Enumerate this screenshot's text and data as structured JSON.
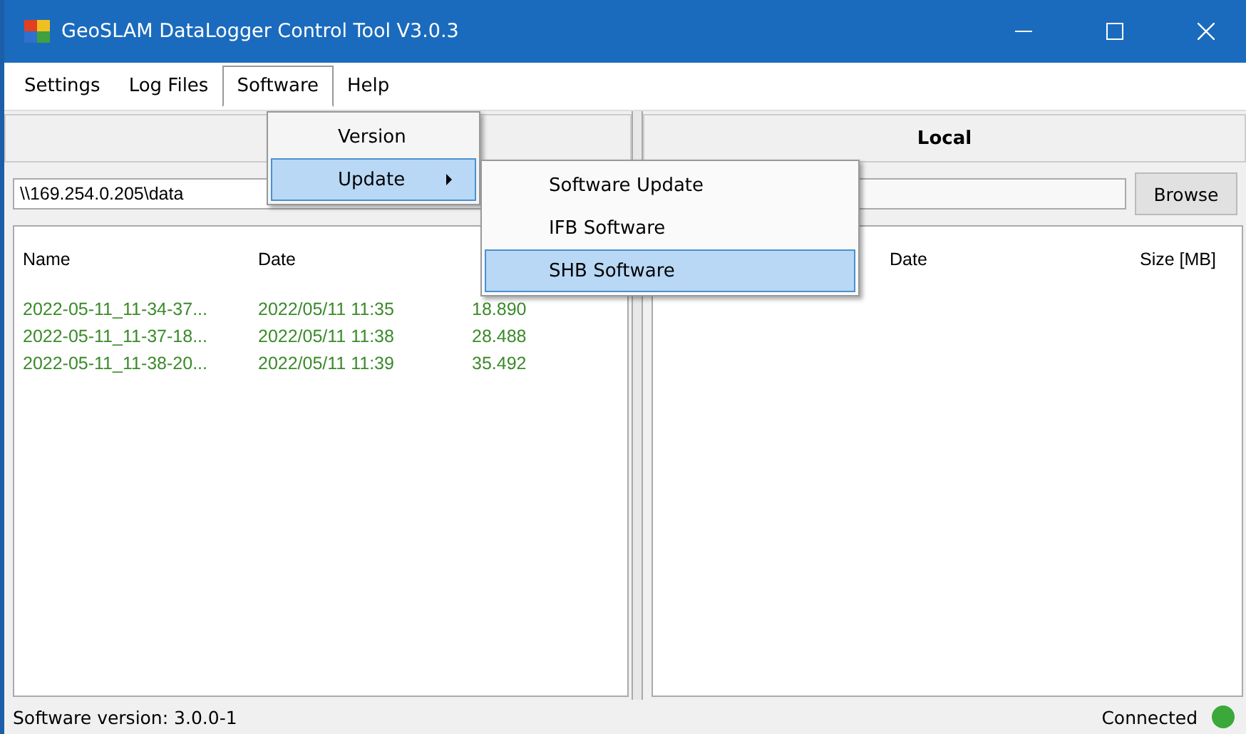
{
  "window": {
    "title": "GeoSLAM DataLogger Control Tool V3.0.3"
  },
  "menu_bar": [
    {
      "label": "Settings",
      "selected": false
    },
    {
      "label": "Log Files",
      "selected": false
    },
    {
      "label": "Software",
      "selected": true
    },
    {
      "label": "Help",
      "selected": false
    }
  ],
  "software_menu": [
    {
      "label": "Version",
      "selected": false,
      "submenu": false
    },
    {
      "label": "Update",
      "selected": true,
      "submenu": true
    }
  ],
  "update_submenu": [
    {
      "label": "Software Update",
      "selected": false
    },
    {
      "label": "IFB Software",
      "selected": false
    },
    {
      "label": "SHB Software",
      "selected": true
    }
  ],
  "remote": {
    "path": "\\\\169.254.0.205\\data",
    "columns": [
      "Name",
      "Date"
    ],
    "rows": [
      {
        "name": "2022-05-11_11-34-37...",
        "date": "2022/05/11 11:35",
        "size": "18.890"
      },
      {
        "name": "2022-05-11_11-37-18...",
        "date": "2022/05/11 11:38",
        "size": "28.488"
      },
      {
        "name": "2022-05-11_11-38-20...",
        "date": "2022/05/11 11:39",
        "size": "35.492"
      }
    ]
  },
  "local": {
    "title": "Local",
    "browse": "Browse",
    "columns": [
      "Date",
      "Size [MB]"
    ]
  },
  "status_bar": {
    "version": "Software version:  3.0.0-1",
    "connection": "Connected",
    "connected": true
  }
}
